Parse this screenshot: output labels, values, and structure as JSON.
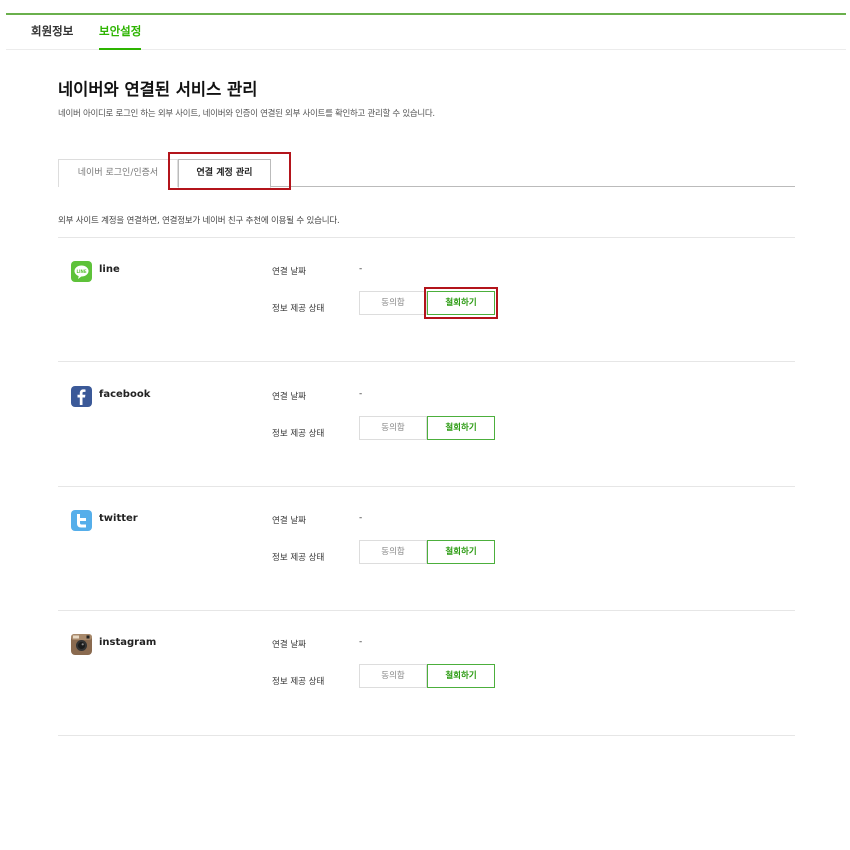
{
  "nav": {
    "tabs": [
      {
        "label": "회원정보"
      },
      {
        "label": "보안설정"
      }
    ]
  },
  "page": {
    "title": "네이버와 연결된 서비스 관리",
    "description": "네이버 아이디로 로그인 하는 외부 사이트, 네이버와 인증이 연결된 외부 사이트를 확인하고 관리할 수 있습니다."
  },
  "subtabs": [
    {
      "label": "네이버 로그인/인증서"
    },
    {
      "label": "연결 계정 관리"
    }
  ],
  "intro": "외부 사이트 계정을 연결하면, 연결정보가 네이버 친구 추천에 이용될 수 있습니다.",
  "labels": {
    "connect_date": "연결 날짜",
    "info_status": "정보 제공 상태",
    "agree": "동의함",
    "revoke": "철회하기"
  },
  "services": [
    {
      "name": "line",
      "date": "-",
      "icon": "line-icon"
    },
    {
      "name": "facebook",
      "date": "-",
      "icon": "facebook-icon"
    },
    {
      "name": "twitter",
      "date": "-",
      "icon": "twitter-icon"
    },
    {
      "name": "instagram",
      "date": "-",
      "icon": "instagram-icon"
    }
  ],
  "colors": {
    "accent": "#2db400",
    "highlight": "#b3141b"
  }
}
